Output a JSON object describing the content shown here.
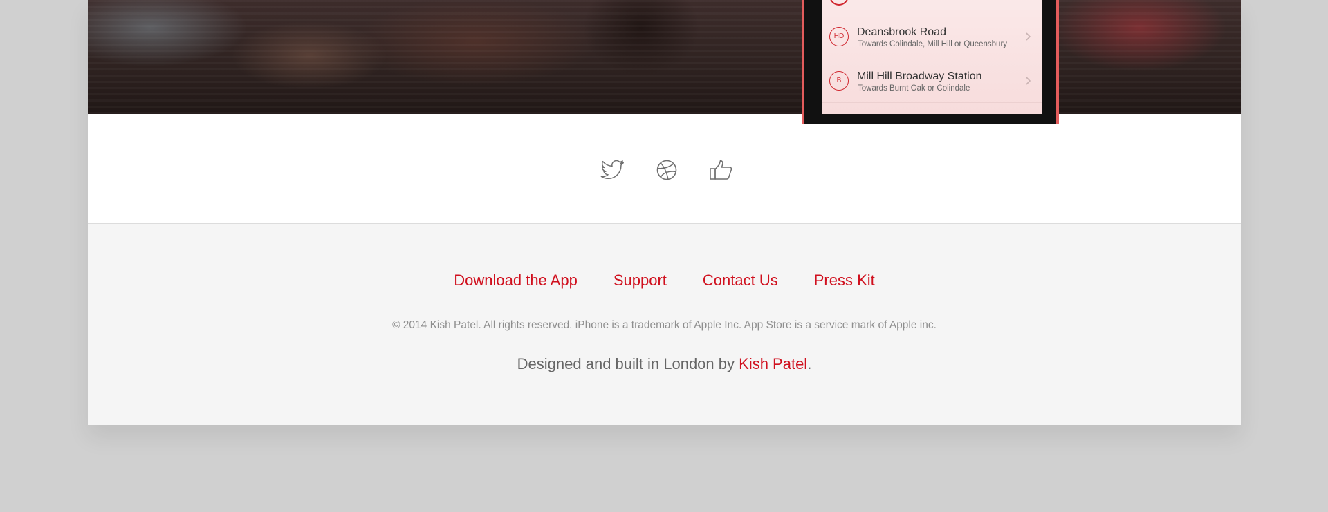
{
  "hero": {
    "phone": {
      "stops": [
        {
          "badge": "HD",
          "name": "Deansbrook Road",
          "direction": "Towards Colindale, Mill Hill or Queensbury"
        },
        {
          "badge": "B",
          "name": "Mill Hill Broadway Station",
          "direction": "Towards Burnt Oak or Colindale"
        }
      ]
    }
  },
  "social": {
    "icons": [
      "twitter-icon",
      "dribbble-icon",
      "thumbs-up-icon"
    ]
  },
  "footer": {
    "links": [
      {
        "label": "Download the App"
      },
      {
        "label": "Support"
      },
      {
        "label": "Contact Us"
      },
      {
        "label": "Press Kit"
      }
    ],
    "copyright": "© 2014 Kish Patel. All rights reserved. iPhone is a trademark of Apple Inc. App Store is a service mark of Apple inc.",
    "credit_prefix": "Designed and built in London by",
    "credit_author": "Kish Patel",
    "credit_suffix": "."
  },
  "colors": {
    "accent": "#d0101e",
    "page_background": "#d0d0d0",
    "footer_background": "#f5f5f5"
  }
}
